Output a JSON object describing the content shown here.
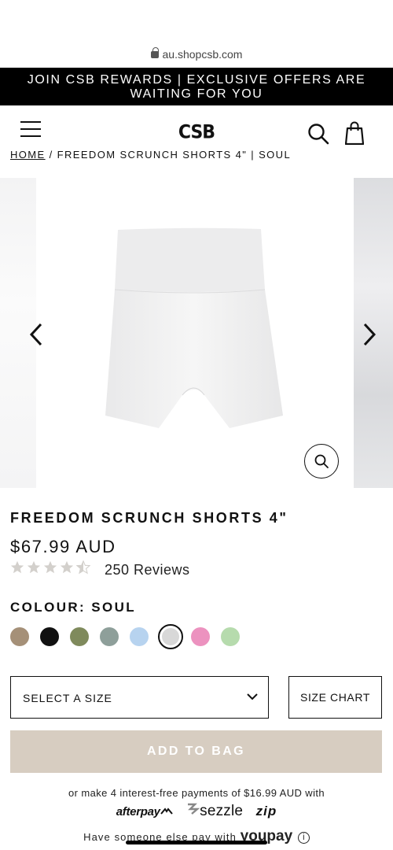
{
  "browser": {
    "url": "au.shopcsb.com"
  },
  "promo_banner": {
    "line1": "JOIN CSB REWARDS | EXCLUSIVE OFFERS ARE",
    "line2": "WAITING FOR YOU"
  },
  "header": {
    "logo": "CSB"
  },
  "breadcrumb": {
    "home": "HOME",
    "separator": " / ",
    "current": "FREEDOM SCRUNCH SHORTS 4\" | SOUL"
  },
  "product": {
    "title": "FREEDOM SCRUNCH SHORTS 4\"",
    "price": "$67.99 AUD",
    "rating": 4.5,
    "rating_max": 5,
    "reviews_text": "250 Reviews",
    "colour_label": "COLOUR: SOUL",
    "swatches": [
      {
        "name": "taupe",
        "color": "#a59078"
      },
      {
        "name": "black",
        "color": "#111111"
      },
      {
        "name": "olive",
        "color": "#7f8a5c"
      },
      {
        "name": "sage-grey",
        "color": "#8e9f9a"
      },
      {
        "name": "sky-blue",
        "color": "#b7d3ef"
      },
      {
        "name": "soul",
        "color": "#d8d8d8",
        "selected": true
      },
      {
        "name": "pink",
        "color": "#ec92bf"
      },
      {
        "name": "mint",
        "color": "#b6dbad"
      }
    ]
  },
  "size": {
    "select_label": "SELECT A SIZE",
    "chart_label": "SIZE CHART"
  },
  "cart": {
    "add_label": "ADD TO BAG",
    "button_color": "#d7cdc1"
  },
  "payments": {
    "installments_text": "or make 4 interest-free payments of $16.99 AUD with",
    "afterpay": "afterpay",
    "sezzle": "sezzle",
    "zip": "zip",
    "youpay_text": "Have someone else pay with",
    "youpay": "youpay"
  }
}
